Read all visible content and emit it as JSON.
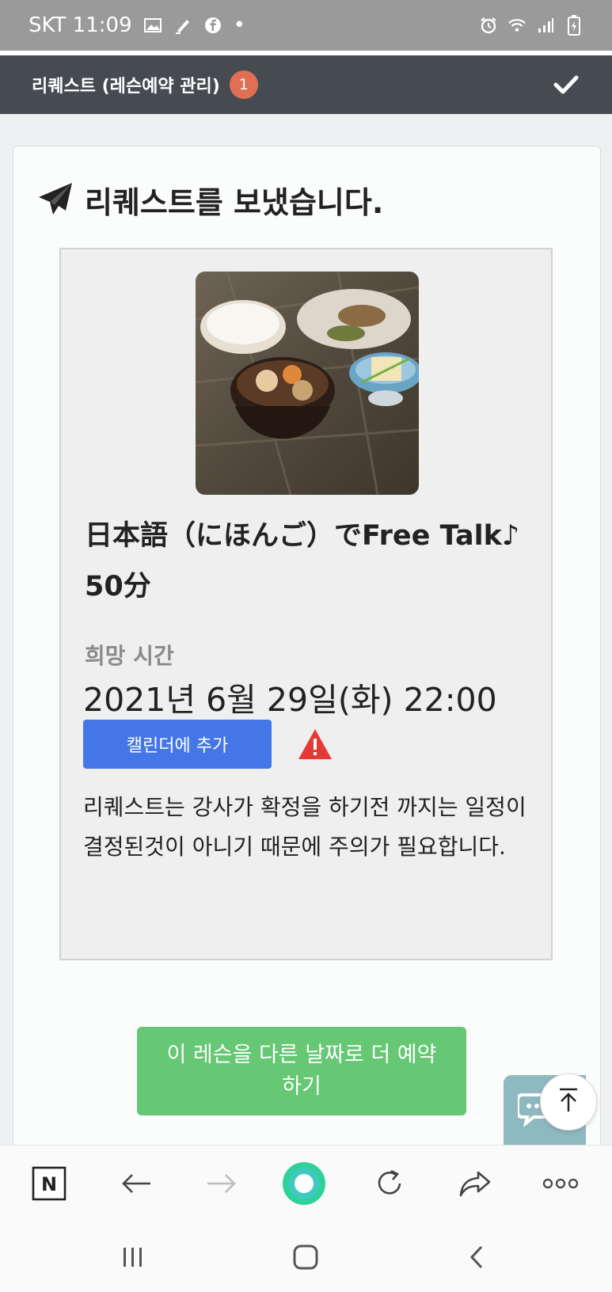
{
  "status_bar": {
    "carrier_time": "SKT 11:09",
    "dot": "•",
    "icons": [
      "image-icon",
      "pen-icon",
      "facebook-icon",
      "alarm-icon",
      "wifi-icon",
      "signal-icon",
      "battery-icon"
    ]
  },
  "header": {
    "title": "리퀘스트 (레슨예약 관리)",
    "badge_count": "1",
    "badge_color": "#e06f53",
    "background": "#464b52"
  },
  "confirmation": {
    "title": "리퀘스트를 보냈습니다."
  },
  "lesson": {
    "title": "日本語（にほんご）でFree Talk♪ 50分",
    "wish_time_label": "희망 시간",
    "wish_time_value": "2021년 6월 29일(화) 22:00",
    "calendar_button": "캘린더에 추가",
    "notice": "리퀘스트는 강사가 확정을 하기전 까지는 일정이 결정된것이 아니기 때문에 주의가 필요합니다."
  },
  "actions": {
    "rebook_button": "이 레슨을 다른 날짜로 더 예약하기",
    "rebook_color": "#66c774",
    "calendar_color": "#4476e8"
  },
  "browser_toolbar": {
    "items": [
      "naver-home-icon",
      "back-arrow-icon",
      "forward-arrow-icon",
      "green-dot-icon",
      "reload-icon",
      "share-icon",
      "more-icon"
    ],
    "home_letter": "N"
  },
  "system_nav": {
    "items": [
      "recent-apps-icon",
      "home-icon",
      "back-icon"
    ]
  }
}
